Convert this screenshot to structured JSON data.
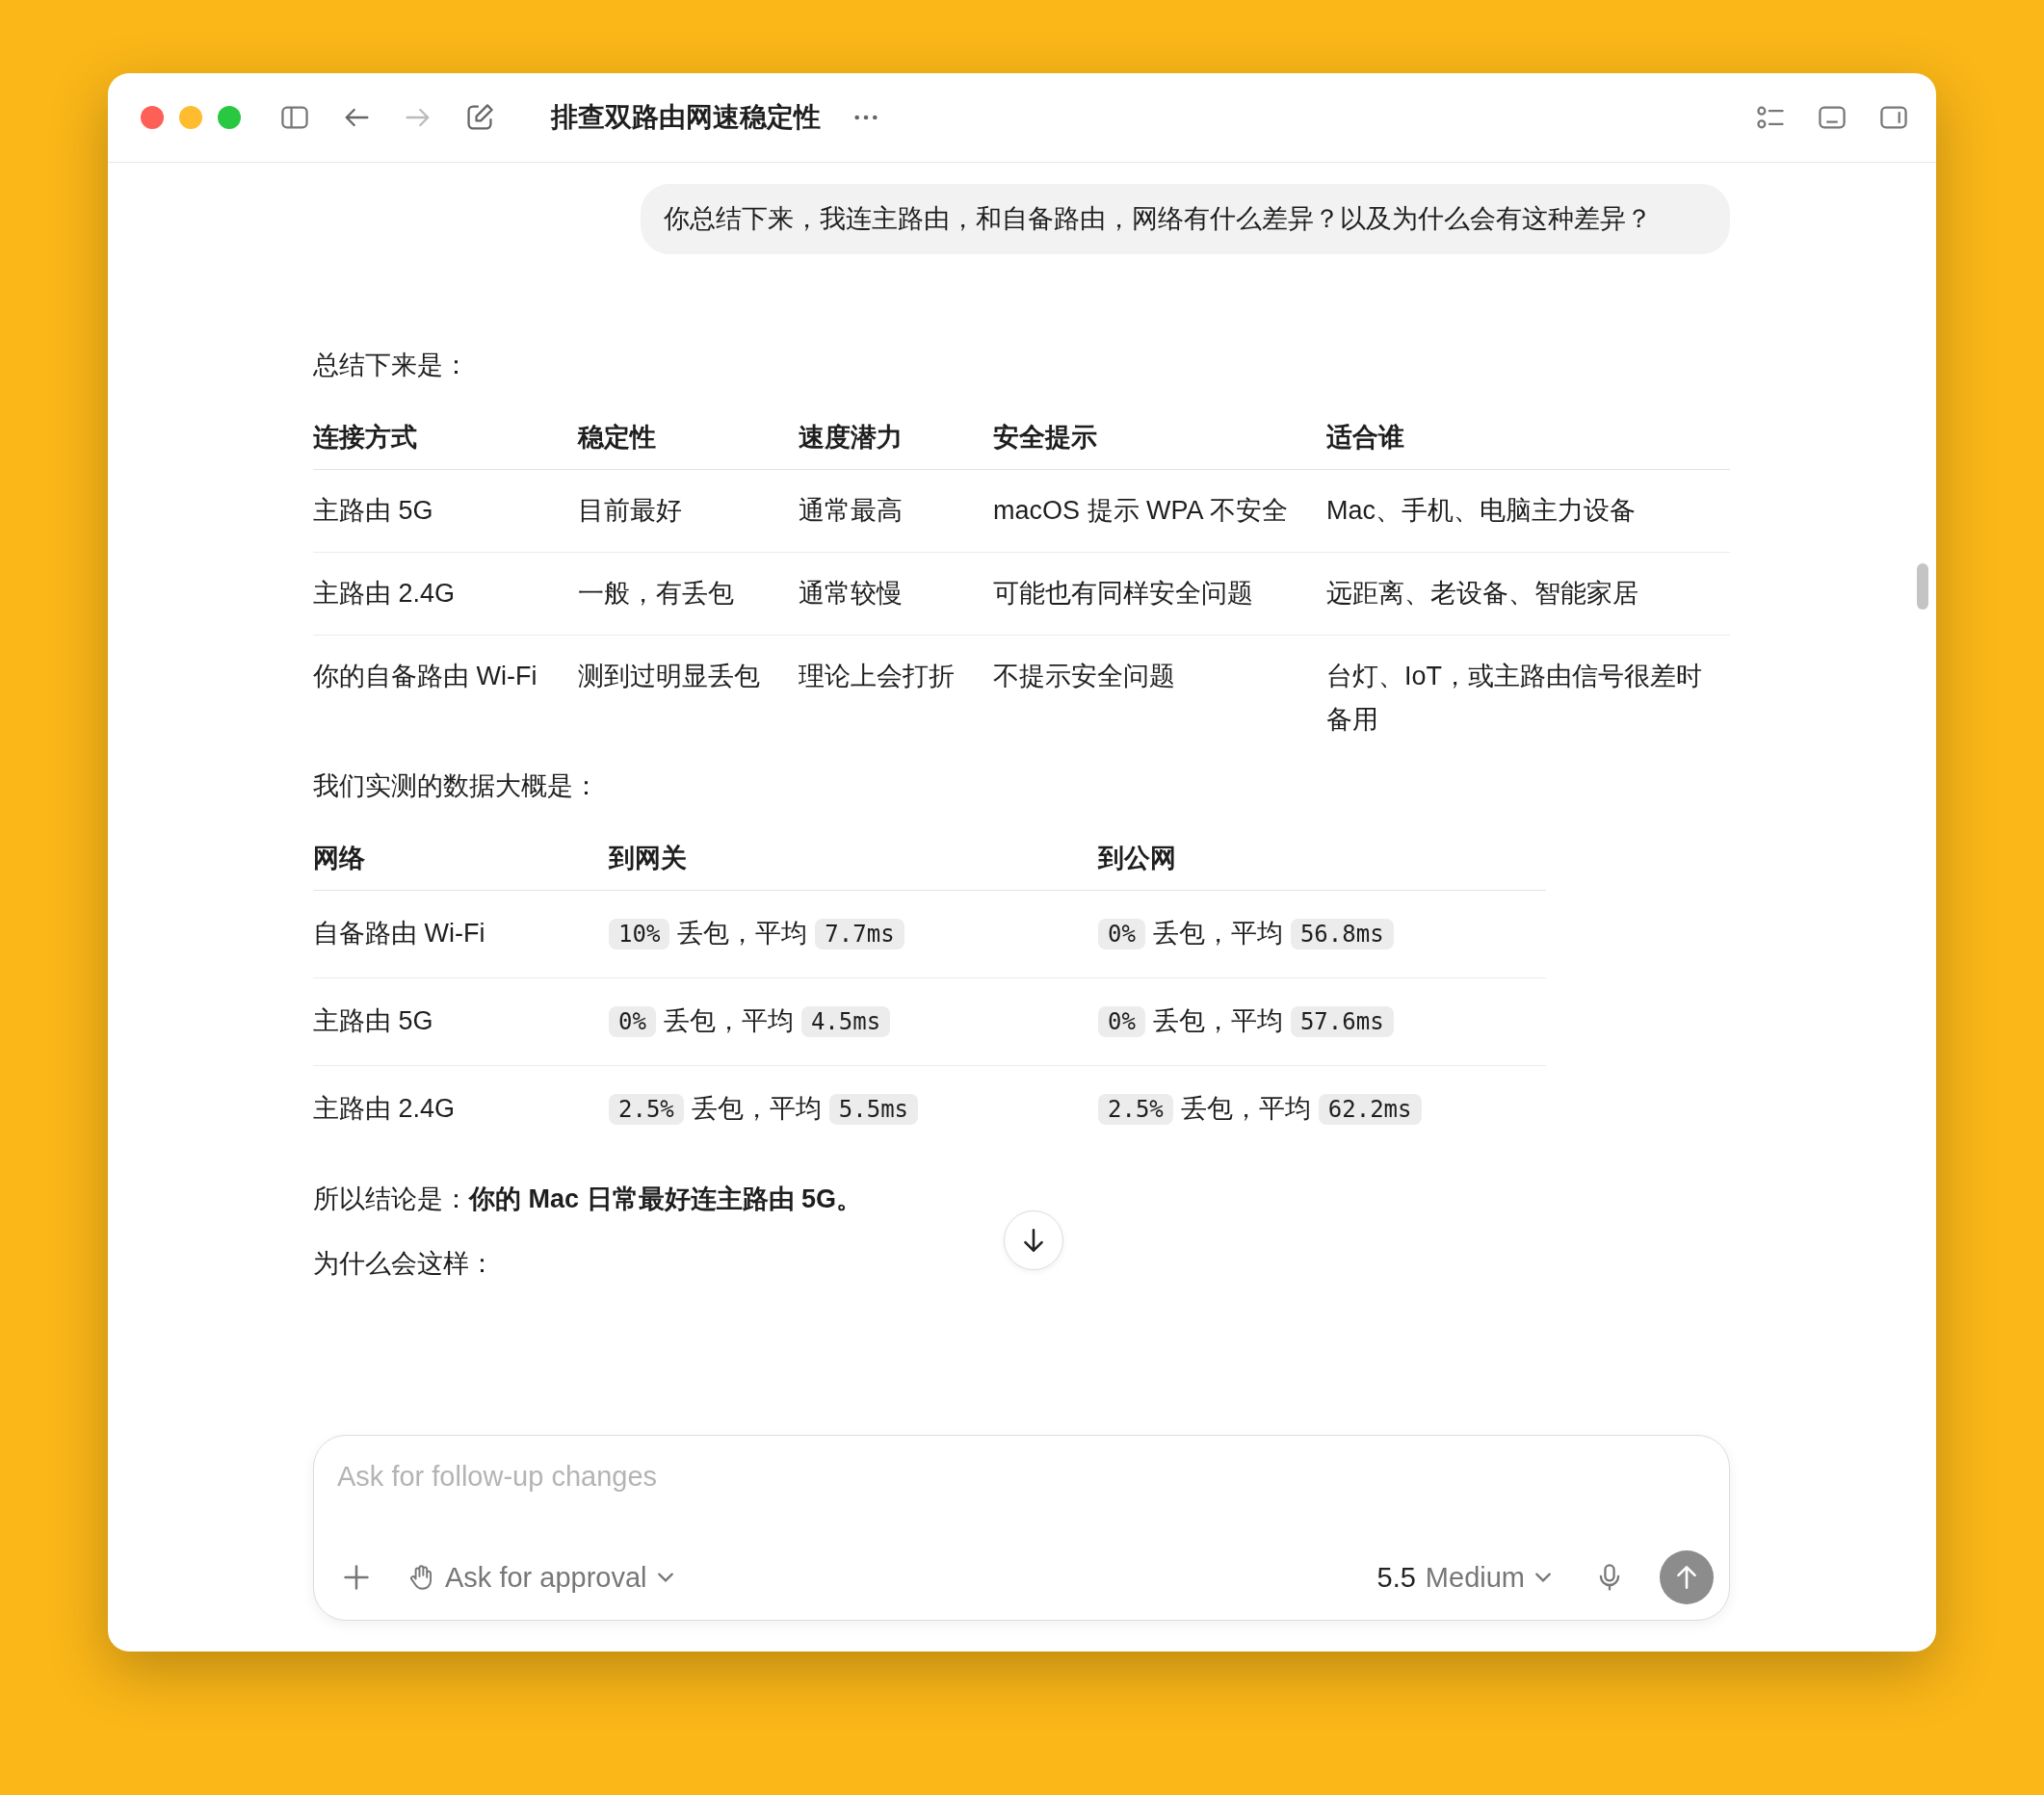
{
  "window": {
    "title": "排查双路由网速稳定性"
  },
  "user_message": "你总结下来，我连主路由，和自备路由，网络有什么差异？以及为什么会有这种差异？",
  "summary_intro": "总结下来是：",
  "comparison_table": {
    "columns": [
      "连接方式",
      "稳定性",
      "速度潜力",
      "安全提示",
      "适合谁"
    ],
    "rows": [
      [
        "主路由 5G",
        "目前最好",
        "通常最高",
        "macOS 提示 WPA 不安全",
        "Mac、手机、电脑主力设备"
      ],
      [
        "主路由 2.4G",
        "一般，有丢包",
        "通常较慢",
        "可能也有同样安全问题",
        "远距离、老设备、智能家居"
      ],
      [
        "你的自备路由 Wi-Fi",
        "测到过明显丢包",
        "理论上会打折",
        "不提示安全问题",
        "台灯、IoT，或主路由信号很差时备用"
      ]
    ]
  },
  "measured_intro": "我们实测的数据大概是：",
  "measurement_table": {
    "columns": [
      "网络",
      "到网关",
      "到公网"
    ],
    "rows": [
      {
        "network": "自备路由 Wi-Fi",
        "gateway": [
          {
            "kind": "code",
            "text": "10%"
          },
          {
            "kind": "text",
            "text": "丢包，平均"
          },
          {
            "kind": "code",
            "text": "7.7ms"
          }
        ],
        "internet": [
          {
            "kind": "code",
            "text": "0%"
          },
          {
            "kind": "text",
            "text": "丢包，平均"
          },
          {
            "kind": "code",
            "text": "56.8ms"
          }
        ]
      },
      {
        "network": "主路由 5G",
        "gateway": [
          {
            "kind": "code",
            "text": "0%"
          },
          {
            "kind": "text",
            "text": "丢包，平均"
          },
          {
            "kind": "code",
            "text": "4.5ms"
          }
        ],
        "internet": [
          {
            "kind": "code",
            "text": "0%"
          },
          {
            "kind": "text",
            "text": "丢包，平均"
          },
          {
            "kind": "code",
            "text": "57.6ms"
          }
        ]
      },
      {
        "network": "主路由 2.4G",
        "gateway": [
          {
            "kind": "code",
            "text": "2.5%"
          },
          {
            "kind": "text",
            "text": "丢包，平均"
          },
          {
            "kind": "code",
            "text": "5.5ms"
          }
        ],
        "internet": [
          {
            "kind": "code",
            "text": "2.5%"
          },
          {
            "kind": "text",
            "text": "丢包，平均"
          },
          {
            "kind": "code",
            "text": "62.2ms"
          }
        ]
      }
    ]
  },
  "conclusion": "所以结论是：**你的 Mac 日常最好连主路由 5G。**",
  "why_heading": "为什么会这样：",
  "composer": {
    "placeholder": "Ask for follow-up changes",
    "approval_mode": "Ask for approval",
    "model_version": "5.5",
    "reasoning_level": "Medium"
  }
}
